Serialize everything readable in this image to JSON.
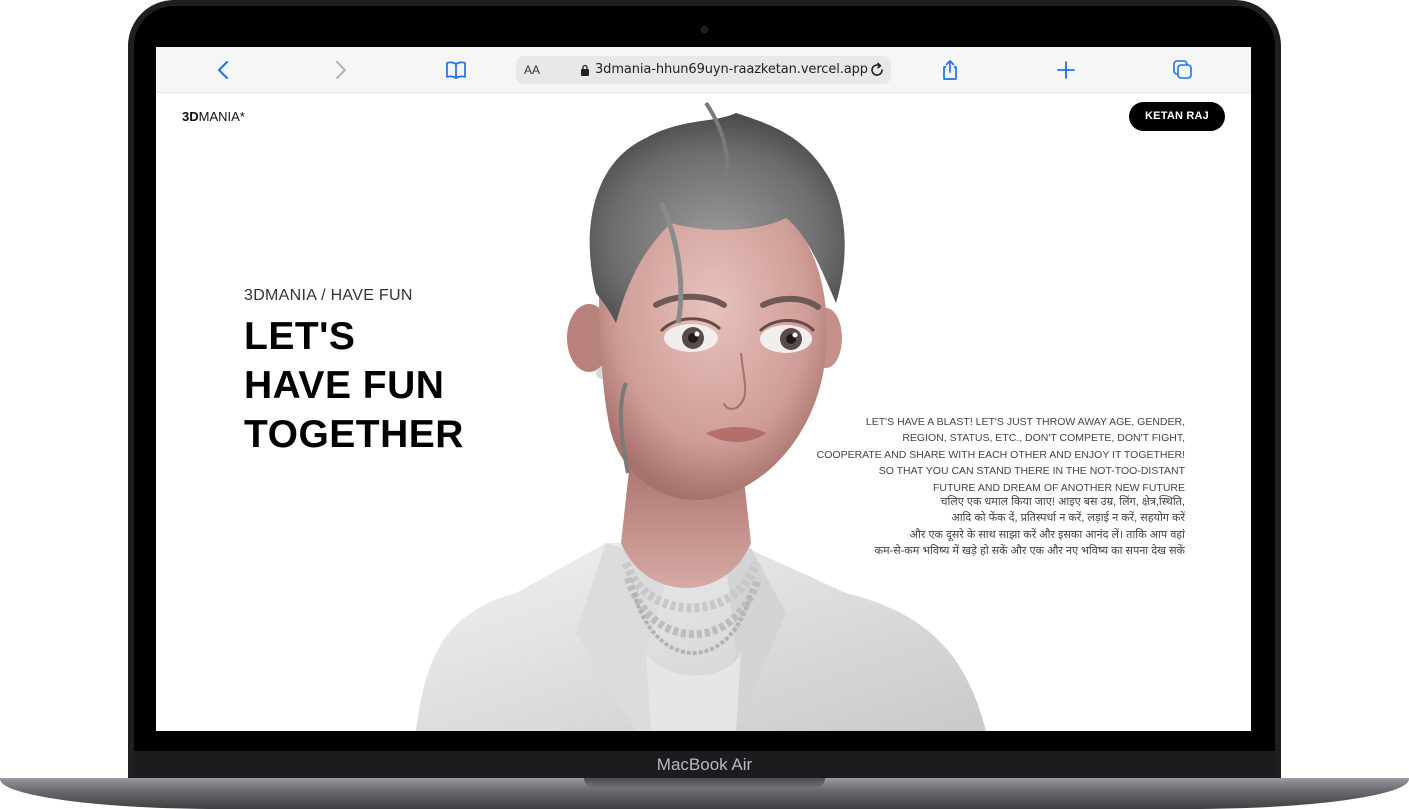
{
  "device": {
    "label": "MacBook Air"
  },
  "browser": {
    "text_size_label": "AA",
    "url": "3dmania-hhun69uyn-raazketan.vercel.app",
    "accent_color": "#1a73e8"
  },
  "site": {
    "logo_bold": "3D",
    "logo_rest": "MANIA*",
    "user_button": "KETAN RAJ",
    "eyebrow": "3DMANIA / HAVE FUN",
    "headline_lines": [
      "LET'S",
      "HAVE FUN",
      "TOGETHER"
    ],
    "blurb_en": [
      "LET'S HAVE A BLAST! LET'S JUST THROW AWAY AGE, GENDER,",
      "REGION, STATUS, ETC., DON'T COMPETE, DON'T FIGHT,",
      "COOPERATE AND SHARE WITH EACH OTHER AND ENJOY IT TOGETHER!",
      "SO THAT YOU CAN STAND THERE IN THE NOT-TOO-DISTANT",
      "FUTURE AND DREAM OF ANOTHER NEW FUTURE"
    ],
    "blurb_hi": [
      "चलिए एक धमाल किया जाए! आइए बस उम्र, लिंग, क्षेत्र,स्थिति,",
      "आदि को फेंक दें, प्रतिस्पर्धा न करें, लड़ाई न करें, सहयोग करें",
      "और एक दूसरे के साथ साझा करें और इसका आनंद लें। ताकि आप वहां",
      "कम-से-कम भविष्य में खड़े हो सकें और एक और नए भविष्य का सपना देख सकें"
    ]
  }
}
